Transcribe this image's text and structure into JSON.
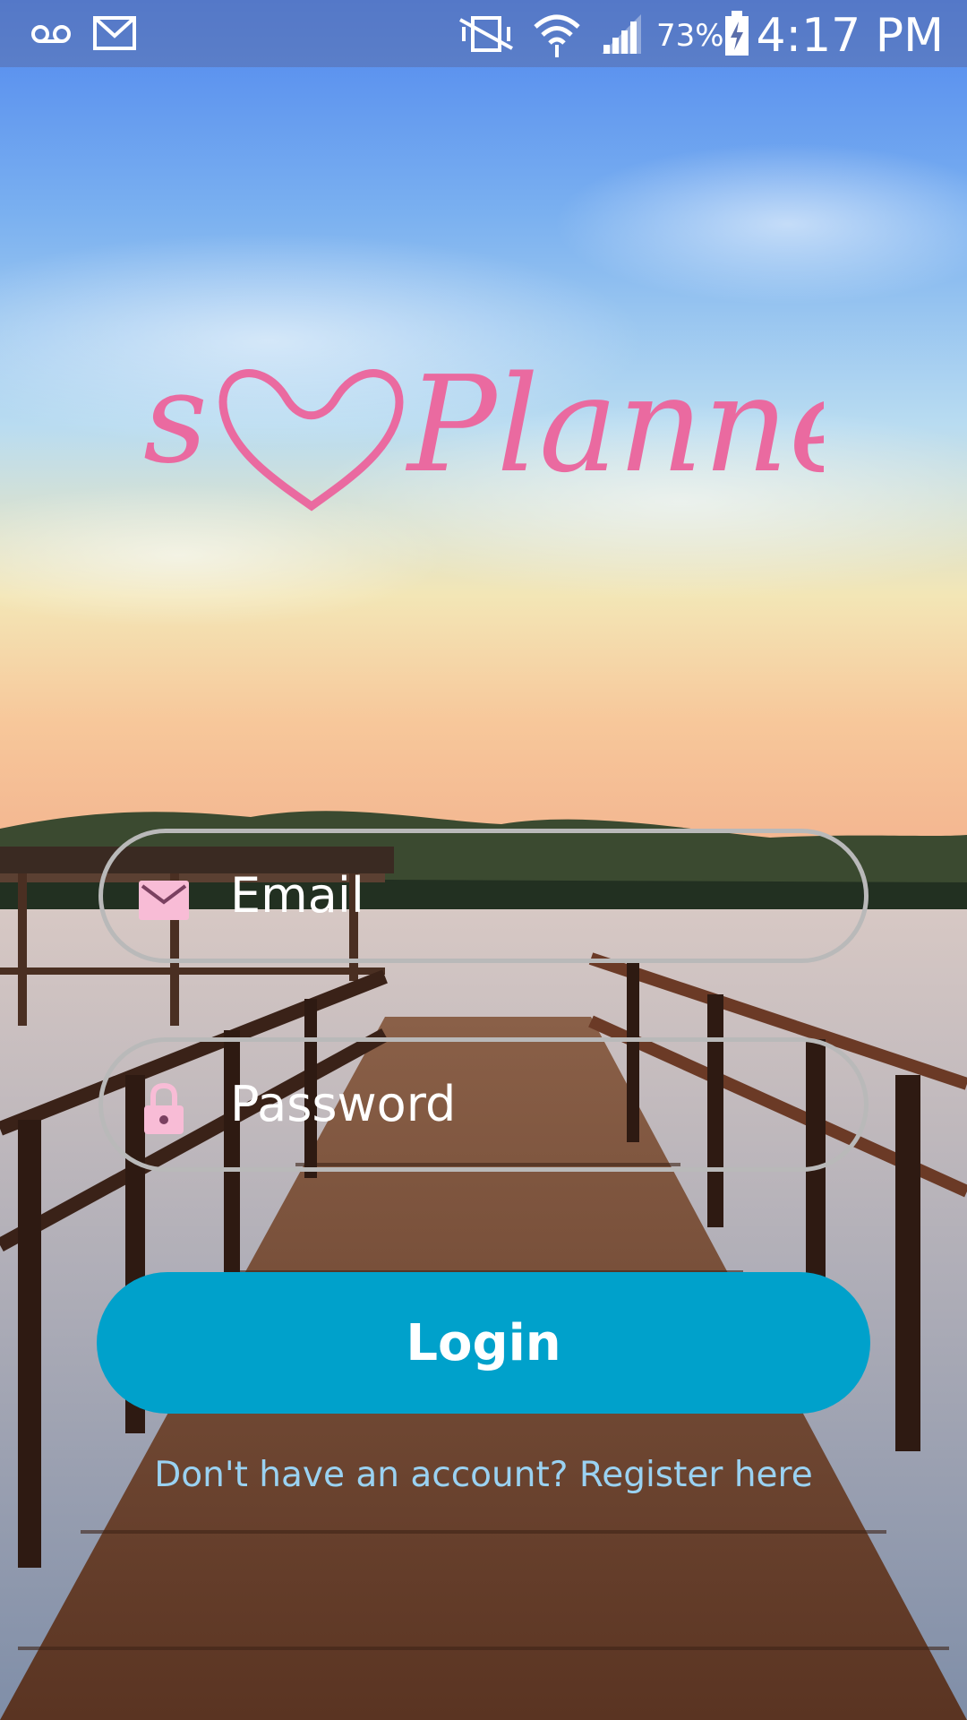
{
  "status_bar": {
    "battery_percent": "73%",
    "time": "4:17 PM",
    "icons": [
      "voicemail-icon",
      "gmail-icon",
      "vibrate-icon",
      "wifi-icon",
      "signal-icon",
      "battery-charging-icon"
    ]
  },
  "logo": {
    "text_before": "s",
    "text_after": "Planner",
    "color": "#ea6aa0"
  },
  "form": {
    "email_placeholder": "Email",
    "password_placeholder": "Password",
    "icon_color": "#f8bcd6"
  },
  "login_button": {
    "label": "Login",
    "color": "#00a1cb"
  },
  "register_link": {
    "label": "Don't have an account? Register here",
    "color": "#9ad2f2"
  }
}
